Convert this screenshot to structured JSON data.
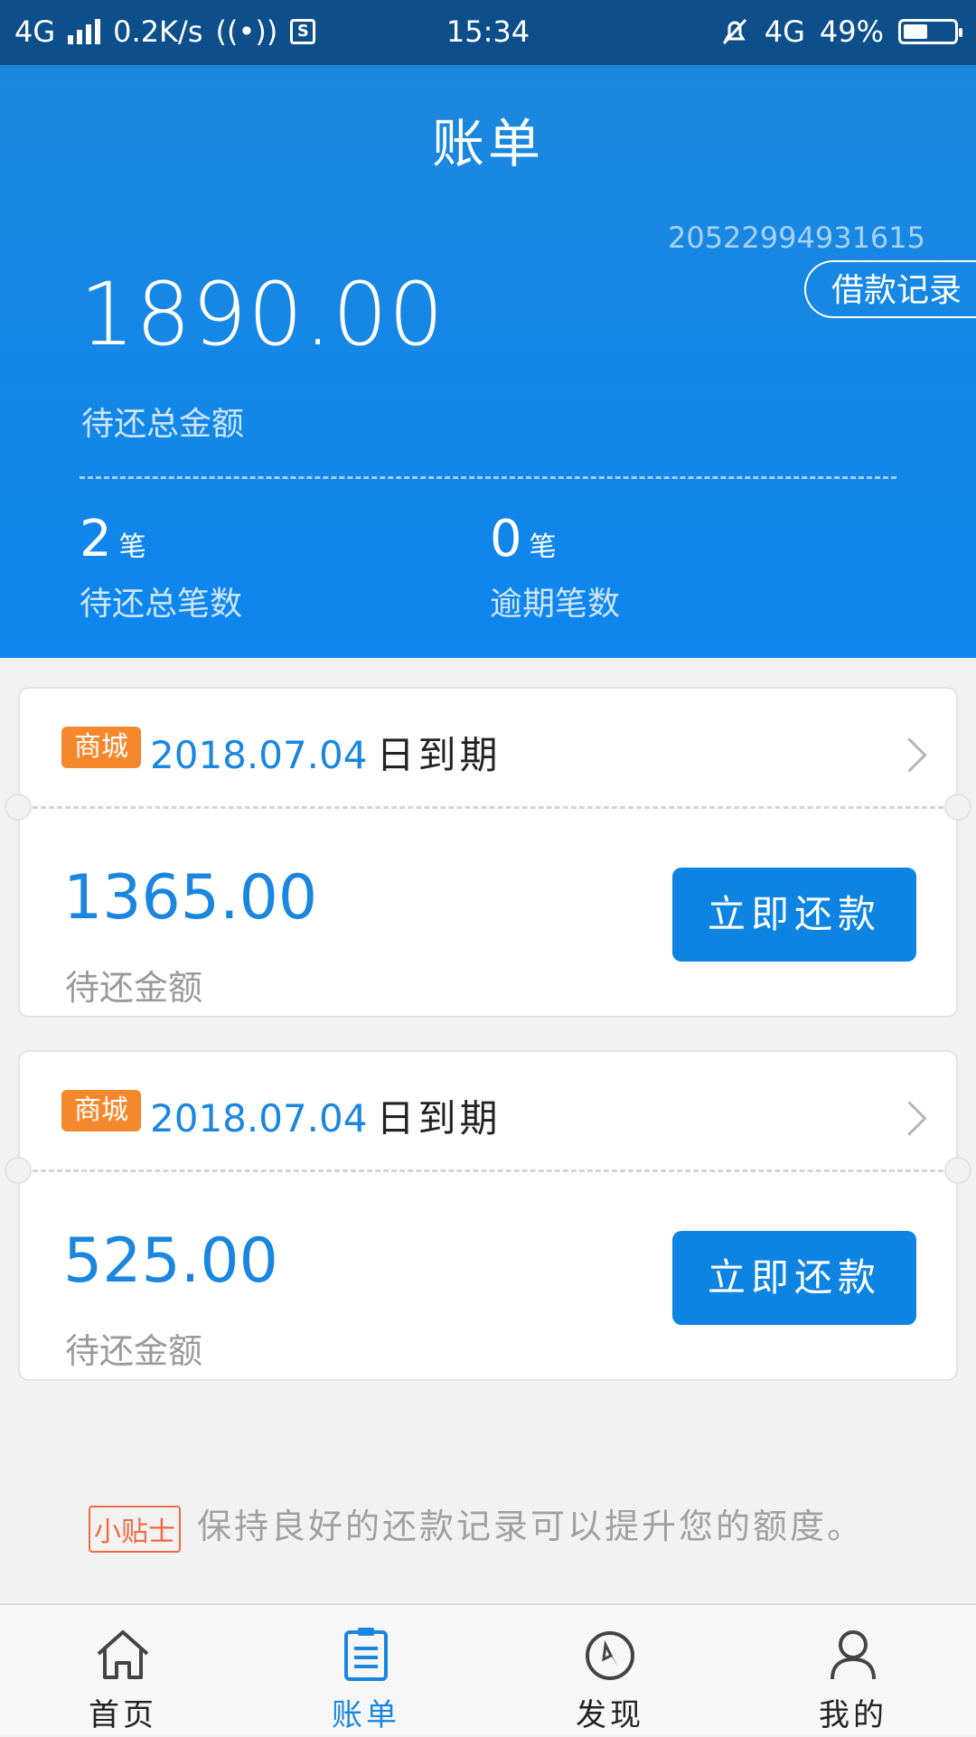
{
  "status_bar": {
    "network": "4G",
    "speed": "0.2K/s",
    "time": "15:34",
    "network_right": "4G",
    "battery_percent": "49%",
    "battery_level": 0.49
  },
  "header": {
    "title": "账单",
    "account_id": "20522994931615",
    "loan_record_label": "借款记录",
    "total_amount": "1890.00",
    "total_label": "待还总金额",
    "pending_count": "2",
    "pending_unit": "笔",
    "pending_label": "待还总笔数",
    "overdue_count": "0",
    "overdue_unit": "笔",
    "overdue_label": "逾期笔数"
  },
  "bills": [
    {
      "tag": "商城",
      "due_date": "2018.07.04",
      "due_suffix": "日到期",
      "amount": "1365.00",
      "amount_label": "待还金额",
      "button_label": "立即还款"
    },
    {
      "tag": "商城",
      "due_date": "2018.07.04",
      "due_suffix": "日到期",
      "amount": "525.00",
      "amount_label": "待还金额",
      "button_label": "立即还款"
    }
  ],
  "tip": {
    "badge": "小贴士",
    "text": "保持良好的还款记录可以提升您的额度。"
  },
  "tabs": [
    {
      "label": "首页",
      "icon": "home-icon"
    },
    {
      "label": "账单",
      "icon": "bill-icon",
      "active": true
    },
    {
      "label": "发现",
      "icon": "compass-icon"
    },
    {
      "label": "我的",
      "icon": "user-icon"
    }
  ],
  "colors": {
    "primary": "#0e84e2",
    "header_top": "#1c88dd",
    "status_bar": "#0d4f8a",
    "tag_orange": "#f5882c",
    "tip_red": "#f06a40"
  }
}
